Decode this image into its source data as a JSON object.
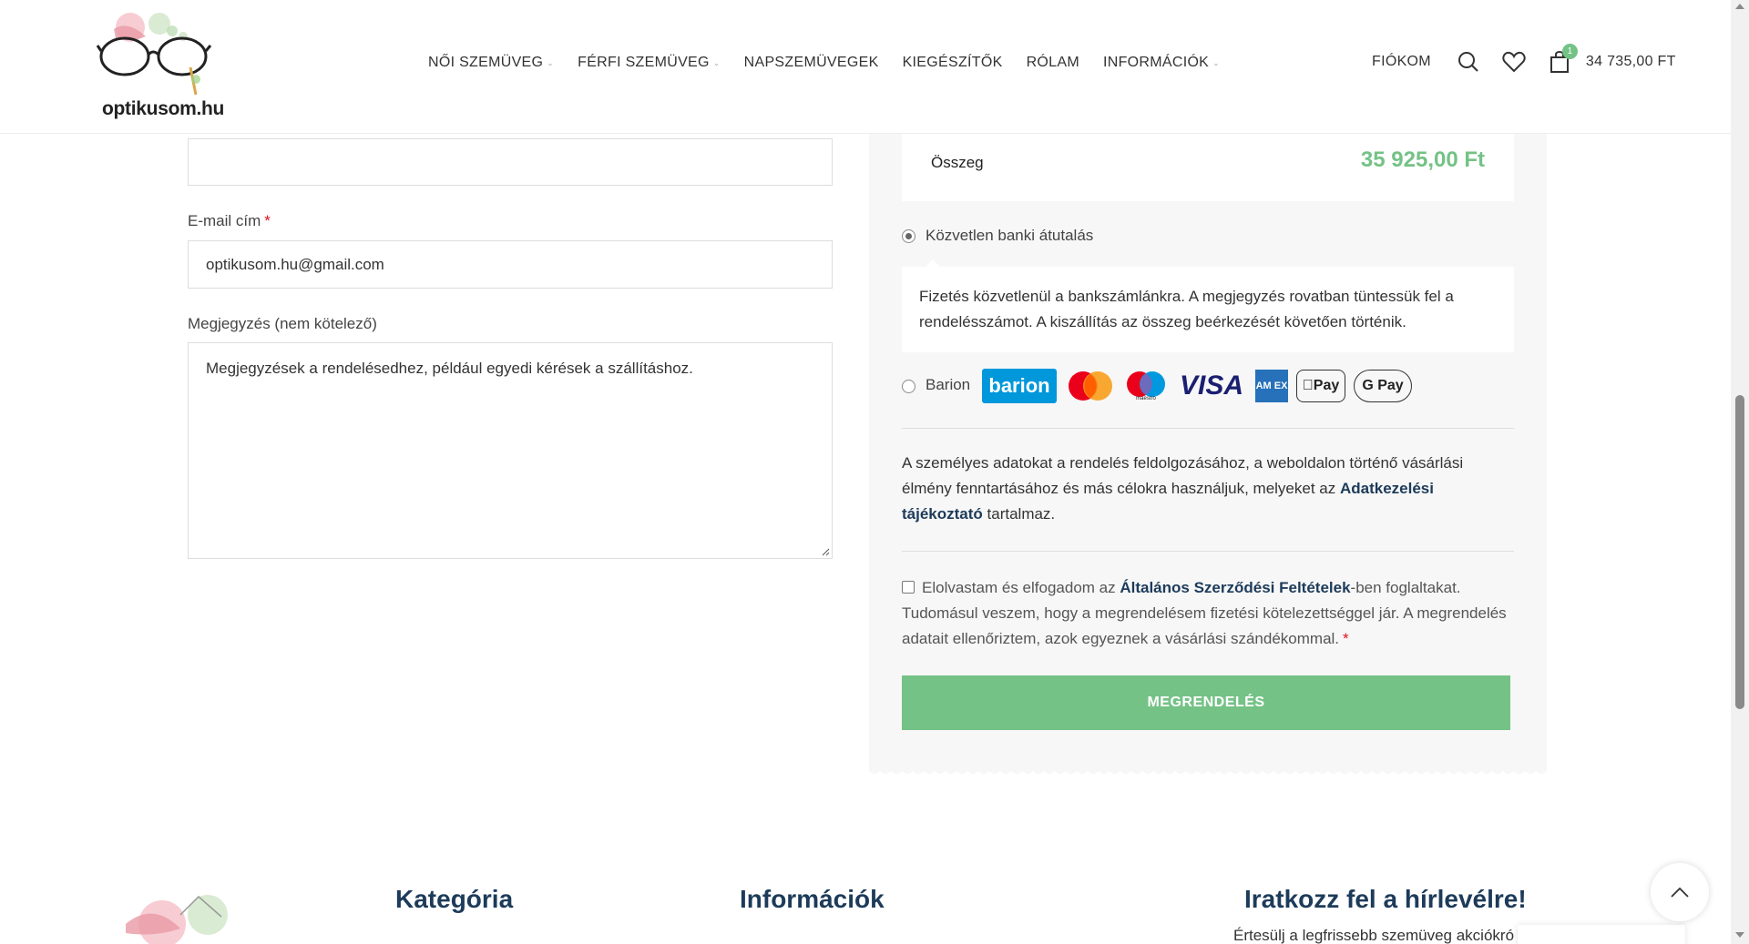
{
  "header": {
    "logo_text": "optikusom.hu",
    "nav": [
      {
        "label": "NŐI SZEMÜVEG",
        "has_dropdown": true
      },
      {
        "label": "FÉRFI SZEMÜVEG",
        "has_dropdown": true
      },
      {
        "label": "NAPSZEMÜVEGEK",
        "has_dropdown": false
      },
      {
        "label": "KIEGÉSZÍTŐK",
        "has_dropdown": false
      },
      {
        "label": "RÓLAM",
        "has_dropdown": false
      },
      {
        "label": "INFORMÁCIÓK",
        "has_dropdown": true
      }
    ],
    "account_label": "FIÓKOM",
    "cart_count": "1",
    "cart_total": "34 735,00 FT"
  },
  "form": {
    "email_label": "E-mail cím",
    "required_mark": "*",
    "email_value": "optikusom.hu@gmail.com",
    "note_label": "Megjegyzés (nem kötelező)",
    "note_placeholder": "Megjegyzések a rendelésedhez, például egyedi kérések a szállításhoz."
  },
  "order": {
    "total_label": "Összeg",
    "total_value": "35 925,00 Ft",
    "payment_bank_label": "Közvetlen banki átutalás",
    "payment_bank_desc": "Fizetés közvetlenül a bankszámlánkra. A megjegyzés rovatban tüntessük fel a rendelésszámot. A kiszállítás az összeg beérkezését követően történik.",
    "payment_barion_label": "Barion",
    "logos": {
      "barion": "barion",
      "visa": "VISA",
      "amex": "AM EX",
      "apple_pay": "Pay",
      "google_pay": "G Pay",
      "maestro": "maestro"
    },
    "privacy_text_1": "A személyes adatokat a rendelés feldolgozásához, a weboldalon történő vásárlási élmény fenntartásához és más célokra használjuk, melyeket az ",
    "privacy_link": "Adatkezelési tájékoztató",
    "privacy_text_2": " tartalmaz.",
    "terms_text_1": "Elolvastam és elfogadom az ",
    "terms_link": "Általános Szerződési Feltételek",
    "terms_text_2": "-ben foglaltakat. Tudomásul veszem, hogy a megrendelésem fizetési kötelezettséggel jár. A megrendelés adatait ellenőriztem, azok egyeznek a vásárlási szándékommal.",
    "order_button": "MEGRENDELÉS"
  },
  "footer": {
    "category_heading": "Kategória",
    "info_heading": "Információk",
    "newsletter_heading": "Iratkozz fel a hírlevélre!",
    "newsletter_sub": "Értesülj a legfrissebb szemüveg akciókró"
  },
  "colors": {
    "accent_green": "#74c286",
    "link_navy": "#1d3b5a",
    "required_red": "#e01020"
  }
}
